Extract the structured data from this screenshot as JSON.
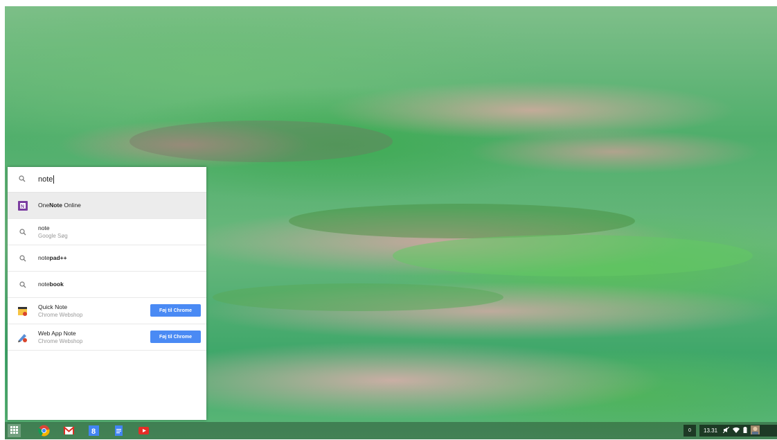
{
  "search": {
    "query": "note"
  },
  "results": [
    {
      "type": "app",
      "title_pre": "One",
      "title_bold": "Note",
      "title_post": " Online",
      "icon": "onenote-icon"
    },
    {
      "type": "search",
      "title_pre": "note",
      "title_bold": "",
      "title_post": "",
      "subtitle": "Google Søg",
      "icon": "search-icon"
    },
    {
      "type": "search",
      "title_pre": "note",
      "title_bold": "pad++",
      "title_post": "",
      "icon": "search-icon"
    },
    {
      "type": "search",
      "title_pre": "note",
      "title_bold": "book",
      "title_post": "",
      "icon": "search-icon"
    },
    {
      "type": "webstore",
      "title": "Quick Note",
      "subtitle": "Chrome Webshop",
      "button": "Føj til Chrome",
      "icon": "quick-note-icon"
    },
    {
      "type": "webstore",
      "title": "Web App Note",
      "subtitle": "Chrome Webshop",
      "button": "Føj til Chrome",
      "icon": "web-app-note-icon"
    }
  ],
  "shelf": {
    "apps": [
      "chrome-icon",
      "gmail-icon",
      "google-plus-icon",
      "docs-icon",
      "youtube-icon"
    ],
    "notification_count": "0",
    "time": "13.31"
  },
  "colors": {
    "accent": "#4a8af4",
    "onenote": "#7b3da0"
  }
}
